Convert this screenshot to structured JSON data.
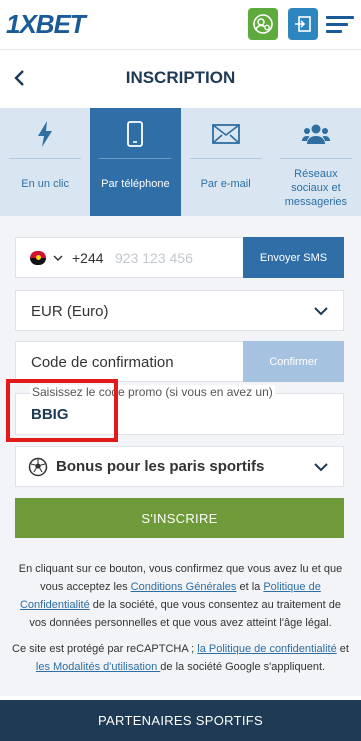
{
  "brand": {
    "logo_text": "1XBET",
    "accent": "#2f6ea6",
    "register_color": "#6f9a39",
    "footer_color": "#1e3a55"
  },
  "header": {
    "title": "INSCRIPTION"
  },
  "tabs": [
    {
      "label": "En un clic",
      "icon": "lightning-icon",
      "active": false
    },
    {
      "label": "Par téléphone",
      "icon": "smartphone-icon",
      "active": true
    },
    {
      "label": "Par e-mail",
      "icon": "envelope-icon",
      "active": false
    },
    {
      "label": "Réseaux sociaux et messageries",
      "icon": "users-icon",
      "active": false
    }
  ],
  "phone": {
    "country_code": "+244",
    "placeholder": "923 123 456",
    "send_sms_label": "Envoyer SMS"
  },
  "currency": {
    "value": "EUR (Euro)"
  },
  "confirmation": {
    "placeholder": "Code de confirmation",
    "confirm_label": "Confirmer"
  },
  "promo": {
    "label": "Saisissez le code promo (si vous en avez un)",
    "value": "BBIG"
  },
  "bonus": {
    "label": "Bonus pour les paris sportifs"
  },
  "register_label": "S'INSCRIRE",
  "legal": {
    "p1_before": "En cliquant sur ce bouton, vous confirmez que vous avez lu et que vous acceptez les ",
    "p1_link1": "Conditions Générales",
    "p1_mid": " et la ",
    "p1_link2": "Politique de Confidentialité",
    "p1_after": " de la société, que vous consentez au traitement de vos données personnelles et que vous avez atteint l'âge légal.",
    "p2_before": "Ce site est protégé par reCAPTCHA ; ",
    "p2_link1": "la Politique de confidentialité",
    "p2_mid": " et ",
    "p2_link2": "les Modalités d'utilisation ",
    "p2_after": "de la société Google s'appliquent."
  },
  "footer": {
    "label": "PARTENAIRES SPORTIFS"
  }
}
